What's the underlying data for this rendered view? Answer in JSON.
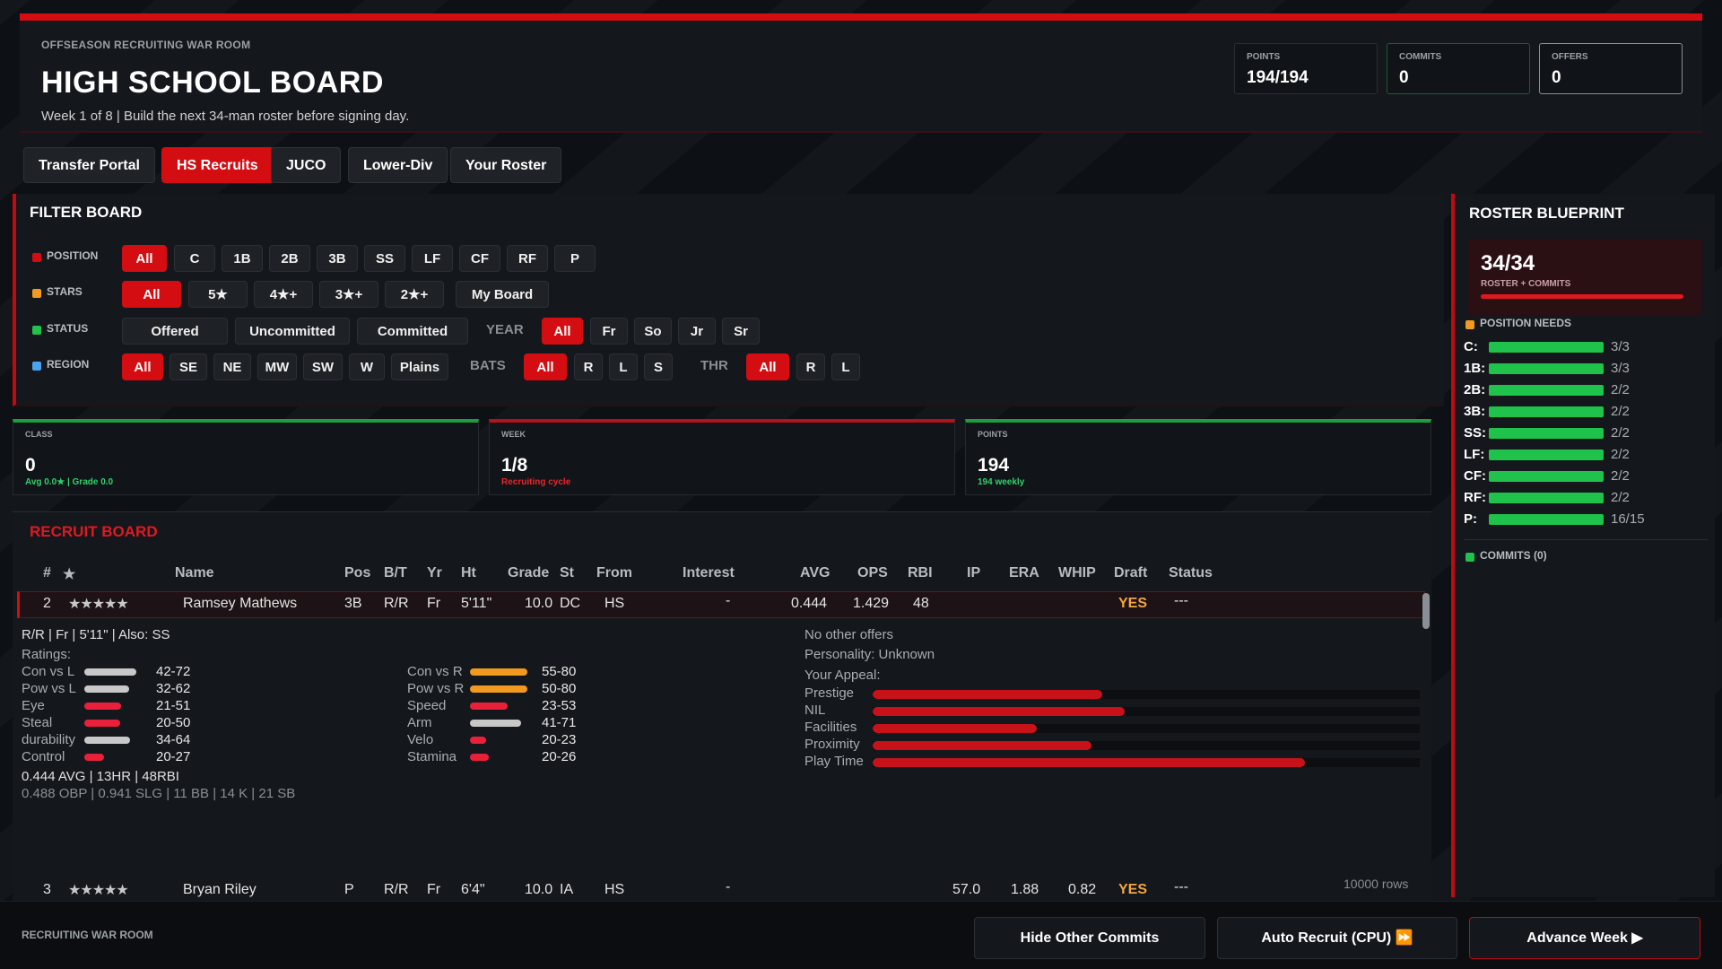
{
  "header": {
    "kicker": "OFFSEASON RECRUITING WAR ROOM",
    "title": "HIGH SCHOOL BOARD",
    "subtitle": "Week 1 of 8 | Build the next 34-man roster before signing day.",
    "stats": [
      {
        "label": "POINTS",
        "value": "194/194"
      },
      {
        "label": "COMMITS",
        "value": "0"
      },
      {
        "label": "OFFERS",
        "value": "0"
      }
    ]
  },
  "tabs": [
    "Transfer Portal",
    "HS Recruits",
    "JUCO",
    "Lower-Div",
    "Your Roster"
  ],
  "filter": {
    "title": "FILTER BOARD",
    "position_label": "POSITION",
    "positions": [
      "All",
      "C",
      "1B",
      "2B",
      "3B",
      "SS",
      "LF",
      "CF",
      "RF",
      "P"
    ],
    "stars_label": "STARS",
    "stars": [
      "All",
      "5★",
      "4★+",
      "3★+",
      "2★+",
      "My Board"
    ],
    "status_label": "STATUS",
    "statuses": [
      "Offered",
      "Uncommitted",
      "Committed"
    ],
    "year_label": "YEAR",
    "years": [
      "All",
      "Fr",
      "So",
      "Jr",
      "Sr"
    ],
    "region_label": "REGION",
    "regions": [
      "All",
      "SE",
      "NE",
      "MW",
      "SW",
      "W",
      "Plains"
    ],
    "bats_label": "BATS",
    "bats": [
      "All",
      "R",
      "L",
      "S"
    ],
    "thr_label": "THR",
    "thr": [
      "All",
      "R",
      "L"
    ],
    "colors": {
      "position": "#d40d12",
      "stars": "#f29a1f",
      "status": "#1fc24a",
      "region": "#4aa3f0"
    }
  },
  "summary": [
    {
      "label": "CLASS",
      "value": "0",
      "sub": "Avg 0.0★ | Grade 0.0"
    },
    {
      "label": "WEEK",
      "value": "1/8",
      "sub": "Recruiting cycle"
    },
    {
      "label": "POINTS",
      "value": "194",
      "sub": "194 weekly"
    }
  ],
  "board": {
    "title": "RECRUIT BOARD",
    "columns": [
      "#",
      "★",
      "Name",
      "Pos",
      "B/T",
      "Yr",
      "Ht",
      "Grade",
      "St",
      "From",
      "Interest",
      "AVG",
      "OPS",
      "RBI",
      "IP",
      "ERA",
      "WHIP",
      "Draft",
      "Status"
    ],
    "rows": [
      {
        "num": "2",
        "stars": "★★★★★",
        "name": "Ramsey Mathews",
        "pos": "3B",
        "bt": "R/R",
        "yr": "Fr",
        "ht": "5'11\"",
        "grade": "10.0",
        "st": "DC",
        "from": "HS",
        "interest": "-",
        "avg": "0.444",
        "ops": "1.429",
        "rbi": "48",
        "ip": "",
        "era": "",
        "whip": "",
        "draft": "YES",
        "status": "---"
      },
      {
        "num": "3",
        "stars": "★★★★★",
        "name": "Bryan Riley",
        "pos": "P",
        "bt": "R/R",
        "yr": "Fr",
        "ht": "6'4\"",
        "grade": "10.0",
        "st": "IA",
        "from": "HS",
        "interest": "-",
        "avg": "",
        "ops": "",
        "rbi": "",
        "ip": "57.0",
        "era": "1.88",
        "whip": "0.82",
        "draft": "YES",
        "status": "---"
      }
    ],
    "row_count": "10000 rows",
    "detail": {
      "summary_line": "R/R  |  Fr  |  5'11\"  |  Also: SS",
      "ratings_label": "Ratings:",
      "ratings_left": [
        {
          "label": "Con vs L",
          "value": "42-72",
          "level": 0.72,
          "color": "#c8c8c8"
        },
        {
          "label": "Pow vs L",
          "value": "32-62",
          "level": 0.62,
          "color": "#c8c8c8"
        },
        {
          "label": "Eye",
          "value": "21-51",
          "level": 0.51,
          "color": "#e8203a"
        },
        {
          "label": "Steal",
          "value": "20-50",
          "level": 0.5,
          "color": "#e8203a"
        },
        {
          "label": "durability",
          "value": "34-64",
          "level": 0.64,
          "color": "#c8c8c8"
        },
        {
          "label": "Control",
          "value": "20-27",
          "level": 0.27,
          "color": "#e8203a"
        }
      ],
      "ratings_right": [
        {
          "label": "Con vs R",
          "value": "55-80",
          "level": 0.8,
          "color": "#f29a1f"
        },
        {
          "label": "Pow vs R",
          "value": "50-80",
          "level": 0.8,
          "color": "#f29a1f"
        },
        {
          "label": "Speed",
          "value": "23-53",
          "level": 0.53,
          "color": "#e8203a"
        },
        {
          "label": "Arm",
          "value": "41-71",
          "level": 0.71,
          "color": "#c8c8c8"
        },
        {
          "label": "Velo",
          "value": "20-23",
          "level": 0.23,
          "color": "#e8203a"
        },
        {
          "label": "Stamina",
          "value": "20-26",
          "level": 0.26,
          "color": "#e8203a"
        }
      ],
      "stat_line": "0.444 AVG | 13HR | 48RBI",
      "stat_line2": "0.488 OBP | 0.941 SLG | 11 BB | 14 K | 21 SB",
      "offers": "No other offers",
      "personality": "Personality: Unknown",
      "appeal_label": "Your Appeal:",
      "appeal": [
        {
          "label": "Prestige",
          "level": 0.42
        },
        {
          "label": "NIL",
          "level": 0.46
        },
        {
          "label": "Facilities",
          "level": 0.3
        },
        {
          "label": "Proximity",
          "level": 0.4
        },
        {
          "label": "Play Time",
          "level": 0.79
        }
      ]
    }
  },
  "blueprint": {
    "title": "ROSTER BLUEPRINT",
    "count": "34/34",
    "count_label": "ROSTER + COMMITS",
    "count_level": 1.0,
    "needs_label": "POSITION NEEDS",
    "needs": [
      {
        "pos": "C:",
        "value": "3/3",
        "level": 1.0
      },
      {
        "pos": "1B:",
        "value": "3/3",
        "level": 1.0
      },
      {
        "pos": "2B:",
        "value": "2/2",
        "level": 1.0
      },
      {
        "pos": "3B:",
        "value": "2/2",
        "level": 1.0
      },
      {
        "pos": "SS:",
        "value": "2/2",
        "level": 1.0
      },
      {
        "pos": "LF:",
        "value": "2/2",
        "level": 1.0
      },
      {
        "pos": "CF:",
        "value": "2/2",
        "level": 1.0
      },
      {
        "pos": "RF:",
        "value": "2/2",
        "level": 1.0
      },
      {
        "pos": "P:",
        "value": "16/15",
        "level": 1.0
      }
    ],
    "commits_label": "COMMITS (0)"
  },
  "footer": {
    "label": "RECRUITING WAR ROOM",
    "hide_commits": "Hide Other Commits",
    "auto_recruit": "Auto Recruit (CPU) ⏩",
    "advance_week": "Advance Week ▶"
  }
}
